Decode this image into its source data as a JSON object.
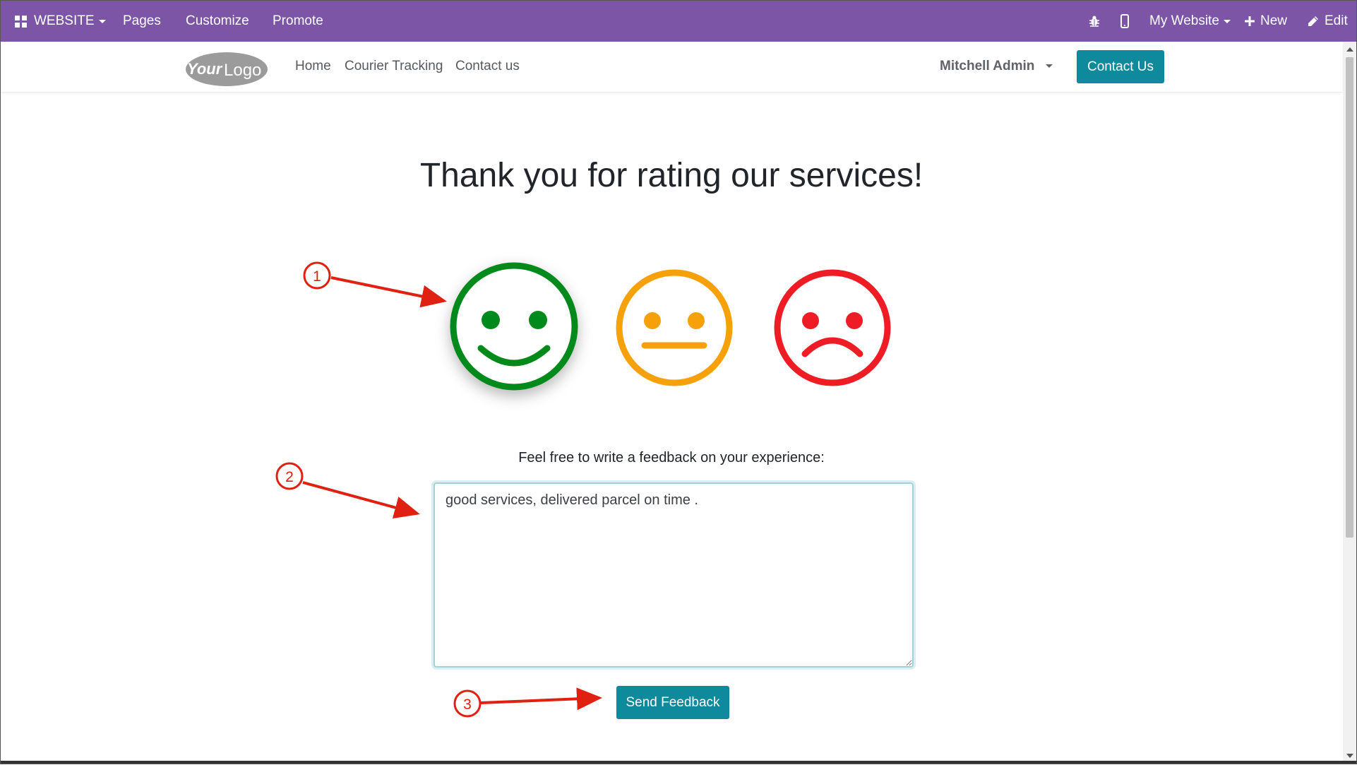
{
  "adminbar": {
    "website_label": "WEBSITE",
    "pages_label": "Pages",
    "customize_label": "Customize",
    "promote_label": "Promote",
    "my_website_label": "My Website",
    "new_label": "New",
    "edit_label": "Edit"
  },
  "header": {
    "logo_text_bold": "Your",
    "logo_text_light": "Logo",
    "nav": [
      "Home",
      "Courier Tracking",
      "Contact us"
    ],
    "user_name": "Mitchell Admin",
    "contact_button": "Contact Us"
  },
  "main": {
    "heading": "Thank you for rating our services!",
    "ratings": [
      {
        "name": "satisfied",
        "color": "#008a1c",
        "selected": true
      },
      {
        "name": "neutral",
        "color": "#f7a10a",
        "selected": false
      },
      {
        "name": "dissatisfied",
        "color": "#ee1c24",
        "selected": false
      }
    ],
    "feedback_label": "Feel free to write a feedback on your experience:",
    "feedback_value": "good services, delivered parcel on time .",
    "send_button": "Send Feedback"
  },
  "annotations": {
    "color": "#e02010",
    "markers": [
      "1",
      "2",
      "3"
    ]
  },
  "colors": {
    "admin_bar": "#7c55a6",
    "primary_button": "#0e8a9c"
  }
}
